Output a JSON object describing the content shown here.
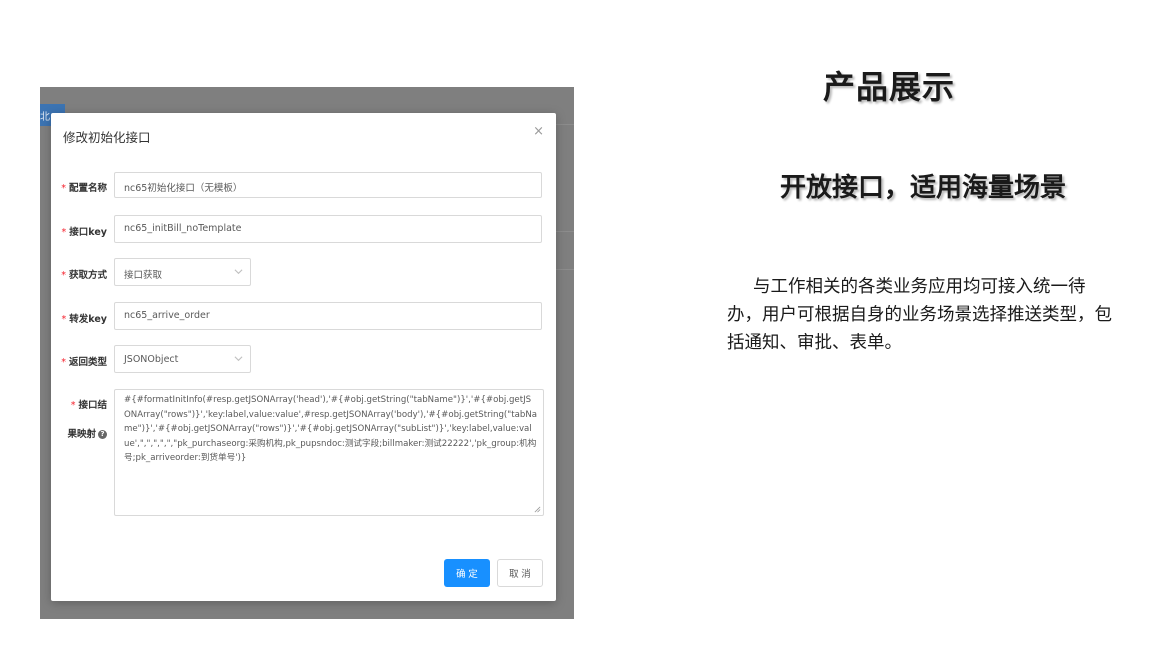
{
  "modal": {
    "title": "修改初始化接口",
    "close_glyph": "×",
    "fields": {
      "config_name": {
        "label": "配置名称",
        "value": "nc65初始化接口（无模板）"
      },
      "interface_key": {
        "label": "接口key",
        "value": "nc65_initBill_noTemplate"
      },
      "fetch_method": {
        "label": "获取方式",
        "value": "接口获取"
      },
      "forward_key": {
        "label": "转发key",
        "value": "nc65_arrive_order"
      },
      "return_type": {
        "label": "返回类型",
        "value": "JSONObject"
      },
      "result_mapping": {
        "label_line1": "接口结",
        "label_line2": "果映射",
        "value": "#{#formatInitInfo(#resp.getJSONArray('head'),'#{#obj.getString(\"tabName\")}','#{#obj.getJSONArray(\"rows\")}','key:label,value:value',#resp.getJSONArray('body'),'#{#obj.getString(\"tabName\")}','#{#obj.getJSONArray(\"rows\")}','#{#obj.getJSONArray(\"subList\")}','key:label,value:value',\",\",\",\",\",\"pk_purchaseorg:采购机构,pk_pupsndoc:测试字段;billmaker:测试22222','pk_group:机构号;pk_arriveorder:到货单号')}"
      }
    },
    "required_mark": "*",
    "help_glyph": "?",
    "buttons": {
      "ok": "确 定",
      "cancel": "取 消"
    }
  },
  "background": {
    "button_text": "北"
  },
  "right": {
    "heading": "产品展示",
    "subheading": "开放接口，适用海量场景",
    "description": "与工作相关的各类业务应用均可接入统一待办，用户可根据自身的业务场景选择推送类型，包括通知、审批、表单。"
  },
  "colors": {
    "primary": "#1890ff",
    "required": "#f5222d",
    "overlay": "#7f7f7f"
  }
}
